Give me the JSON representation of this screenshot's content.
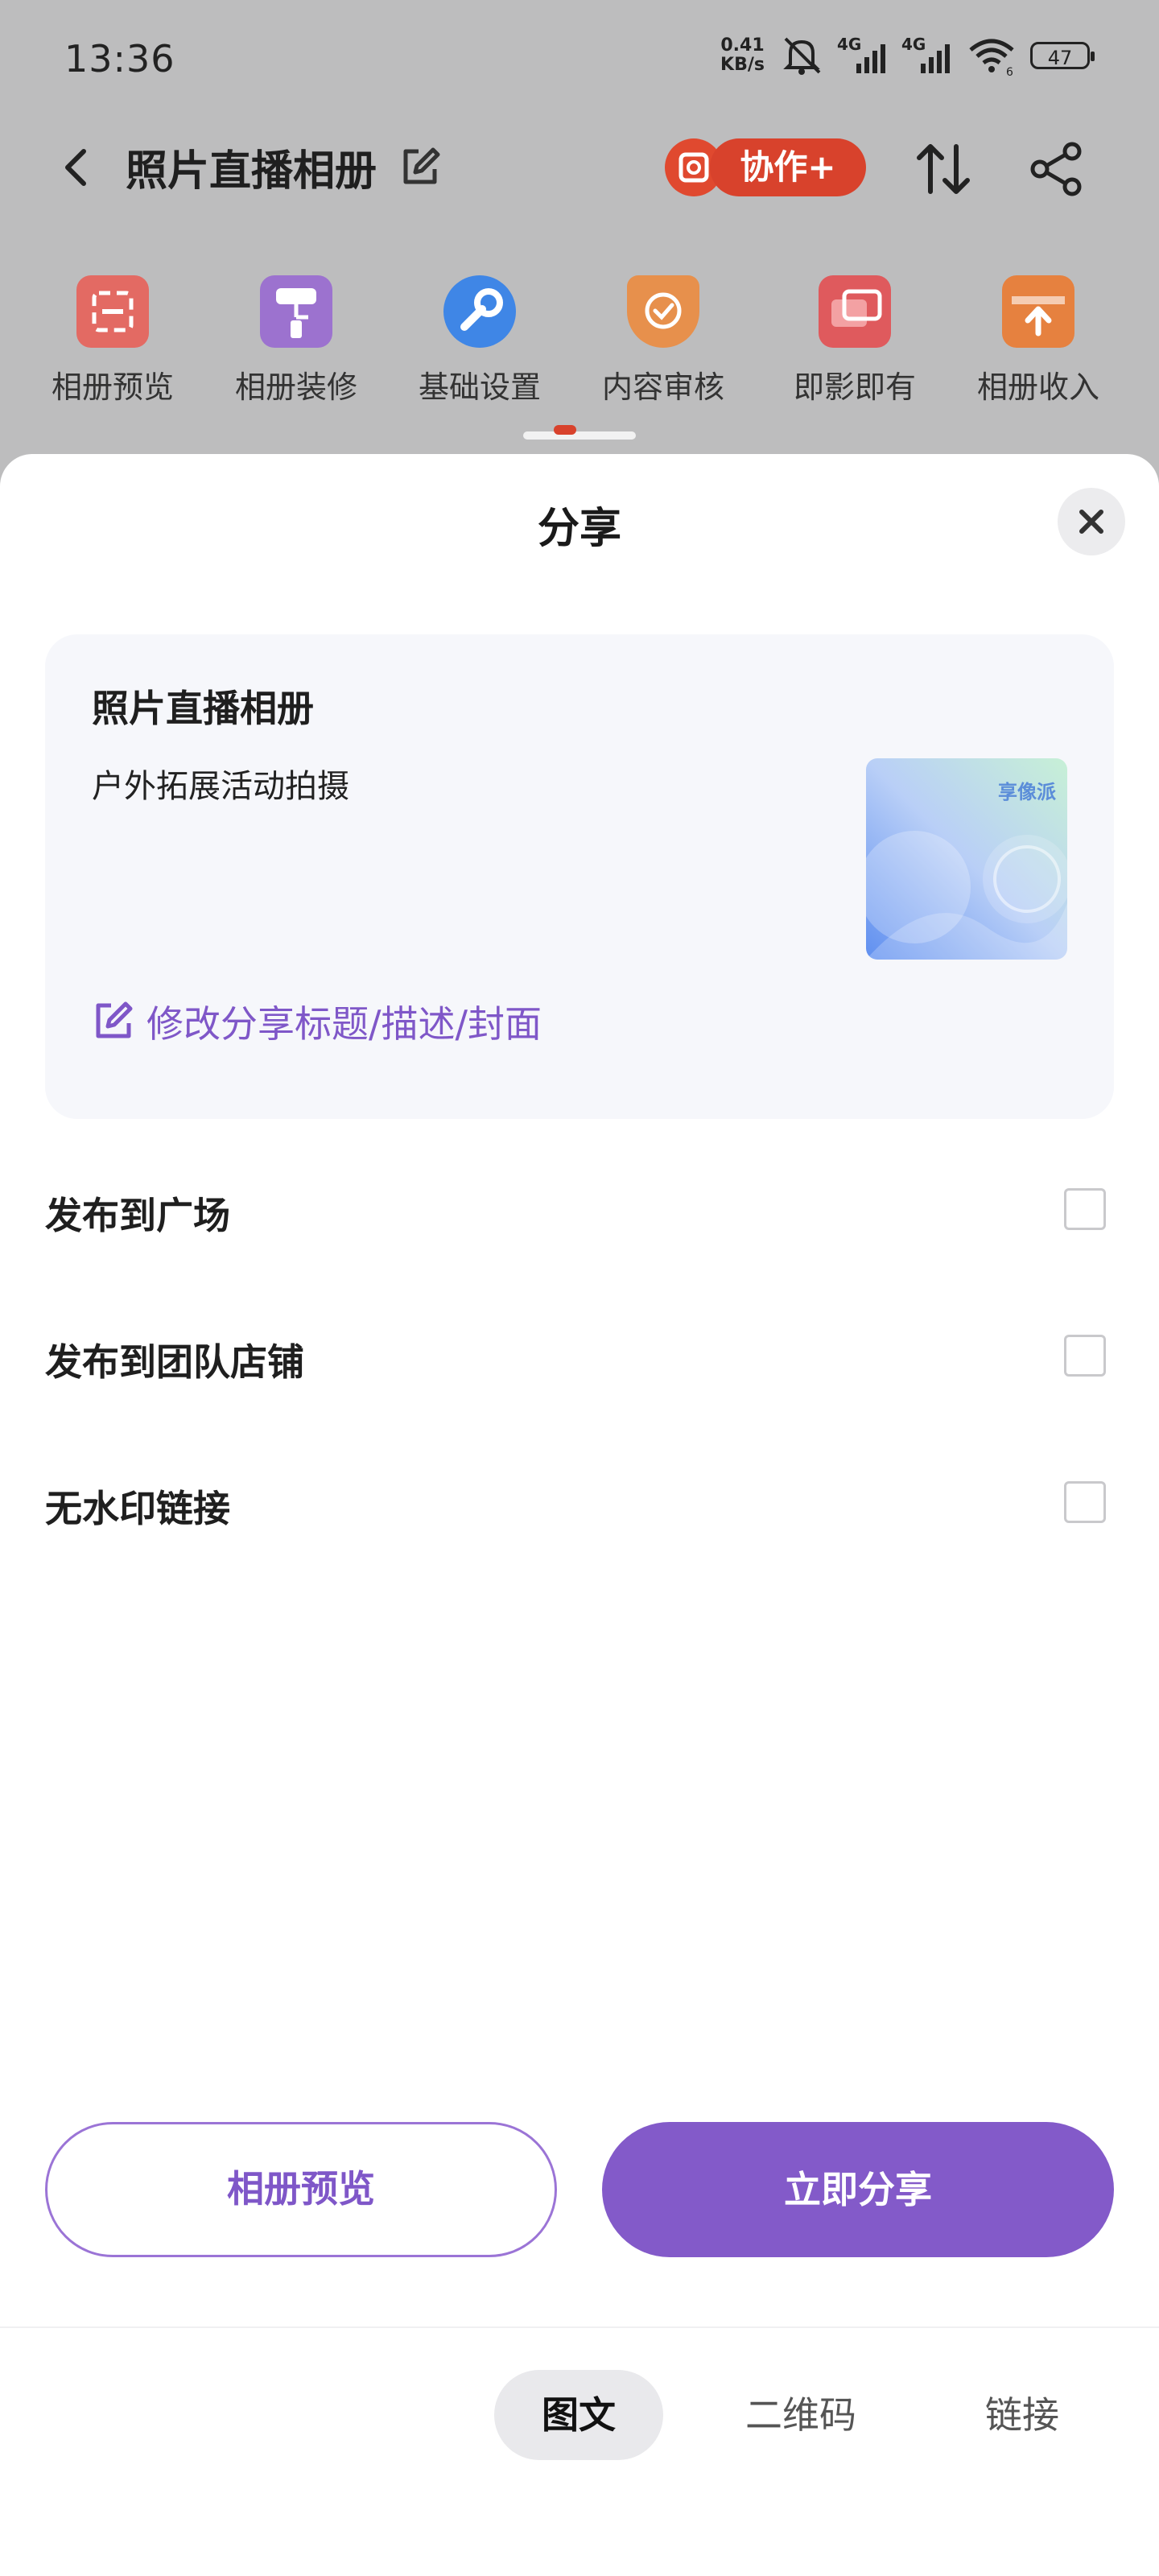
{
  "status_bar": {
    "time": "13:36",
    "net_speed_value": "0.41",
    "net_speed_unit": "KB/s",
    "signal1_label": "4G",
    "signal2_label": "4G",
    "wifi_sub": "6",
    "battery": "47"
  },
  "app_header": {
    "title": "照片直播相册",
    "collab_label": "协作+",
    "accent_color": "#d8422c"
  },
  "toolbar": {
    "items": [
      {
        "label": "相册预览",
        "icon": "album-preview-icon"
      },
      {
        "label": "相册装修",
        "icon": "decoration-roller-icon"
      },
      {
        "label": "基础设置",
        "icon": "wrench-icon"
      },
      {
        "label": "内容审核",
        "icon": "shield-check-icon"
      },
      {
        "label": "即影即有",
        "icon": "instant-photo-icon"
      },
      {
        "label": "相册收入",
        "icon": "income-tray-icon"
      }
    ]
  },
  "sheet": {
    "title": "分享",
    "card": {
      "title": "照片直播相册",
      "description": "户外拓展活动拍摄",
      "cover_logo": "享像派",
      "edit_link": "修改分享标题/描述/封面"
    },
    "options": [
      {
        "label": "发布到广场",
        "checked": false
      },
      {
        "label": "发布到团队店铺",
        "checked": false
      },
      {
        "label": "无水印链接",
        "checked": false
      }
    ],
    "preview_button": "相册预览",
    "share_button": "立即分享",
    "primary_color": "#835ac9",
    "tabs": [
      {
        "label": "图文",
        "active": true
      },
      {
        "label": "二维码",
        "active": false
      },
      {
        "label": "链接",
        "active": false
      }
    ]
  }
}
